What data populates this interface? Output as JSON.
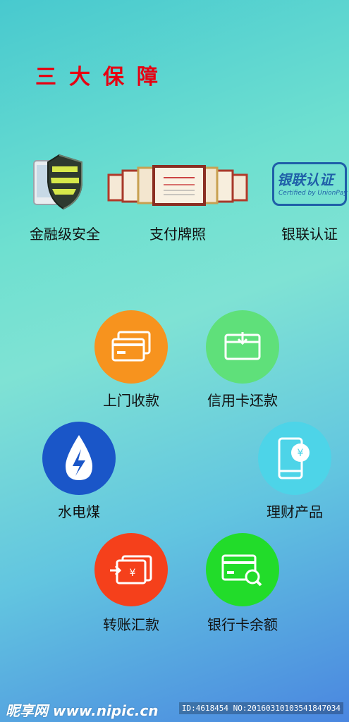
{
  "title": "三大保障",
  "guarantees": [
    {
      "label": "金融级安全",
      "icon": "shield-phone-icon"
    },
    {
      "label": "支付牌照",
      "icon": "certificates-icon"
    },
    {
      "label": "银联认证",
      "icon": "unionpay-certified-icon"
    }
  ],
  "unionpay_logo": {
    "line1": "银联认证",
    "line2": "Certified by UnionPay"
  },
  "services": [
    {
      "label": "上门收款",
      "icon": "cards-icon",
      "color": "#f7931e"
    },
    {
      "label": "信用卡还款",
      "icon": "card-arrow-icon",
      "color": "#5fe07a"
    },
    {
      "label": "水电煤",
      "icon": "water-drop-lightning-icon",
      "color": "#1a56c8"
    },
    {
      "label": "理财产品",
      "icon": "phone-yen-icon",
      "color": "#4dd4e8"
    },
    {
      "label": "转账汇款",
      "icon": "transfer-yen-icon",
      "color": "#f5401b"
    },
    {
      "label": "银行卡余额",
      "icon": "card-search-icon",
      "color": "#22dc2a"
    }
  ],
  "watermark": {
    "site": "昵享网 www.nipic.cn",
    "id": "ID:4618454 NO:20160310103541847034"
  }
}
